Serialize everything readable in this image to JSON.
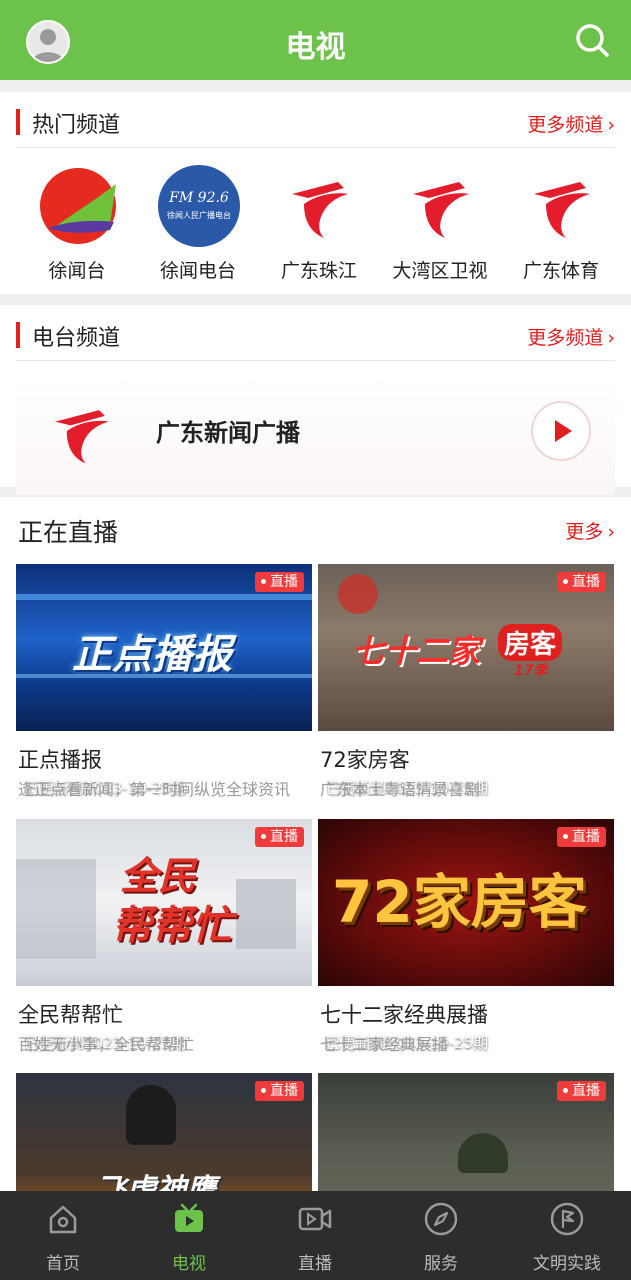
{
  "header": {
    "title": "电视",
    "avatar_icon": "user-avatar-icon",
    "search_icon": "search-icon"
  },
  "hot_channels": {
    "title": "热门频道",
    "more": "更多频道",
    "items": [
      {
        "name": "徐闻台"
      },
      {
        "name": "徐闻电台",
        "logo_text": "FM 92.6",
        "logo_subtext": "徐闻人民广播电台"
      },
      {
        "name": "广东珠江"
      },
      {
        "name": "大湾区卫视"
      },
      {
        "name": "广东体育"
      }
    ]
  },
  "radio_channels": {
    "title": "电台频道",
    "more": "更多频道",
    "item": {
      "name": "广东新闻广播"
    }
  },
  "live": {
    "title": "正在直播",
    "more": "更多",
    "badge": "直播",
    "items": [
      {
        "title": "正点播报",
        "desc": "逢正点看新闻，第一时间纵览全球资讯",
        "updated": "已更新到2023-10-25期",
        "thumb_text": "正点播报"
      },
      {
        "title": "72家房客",
        "desc": "广东本土粤语情景喜剧",
        "updated": "已更新到2023-10-25期",
        "thumb_text": "七十二家",
        "thumb_text2": "房客",
        "thumb_text3": "17季"
      },
      {
        "title": "全民帮帮忙",
        "desc": "百姓无小事，全民帮帮忙",
        "updated": "已更新到2023-10-25期",
        "thumb_text": "全民",
        "thumb_text2": "帮帮忙"
      },
      {
        "title": "七十二家经典展播",
        "desc": "七十二家经典展播",
        "updated": "已更新到2023-10-25期",
        "thumb_text": "72家房客"
      },
      {
        "title": "",
        "desc": "",
        "updated": "",
        "thumb_text": "飞虎神鹰"
      },
      {
        "title": "",
        "desc": "",
        "updated": "",
        "thumb_text": ""
      }
    ]
  },
  "bottom_nav": [
    {
      "label": "首页",
      "icon": "home-icon"
    },
    {
      "label": "电视",
      "icon": "tv-icon",
      "active": true
    },
    {
      "label": "直播",
      "icon": "live-video-icon"
    },
    {
      "label": "服务",
      "icon": "compass-icon"
    },
    {
      "label": "文明实践",
      "icon": "flag-icon"
    }
  ],
  "colors": {
    "brand_green": "#6cc24a",
    "accent_red": "#e0201f",
    "nav_bg": "#2d2d2d"
  }
}
